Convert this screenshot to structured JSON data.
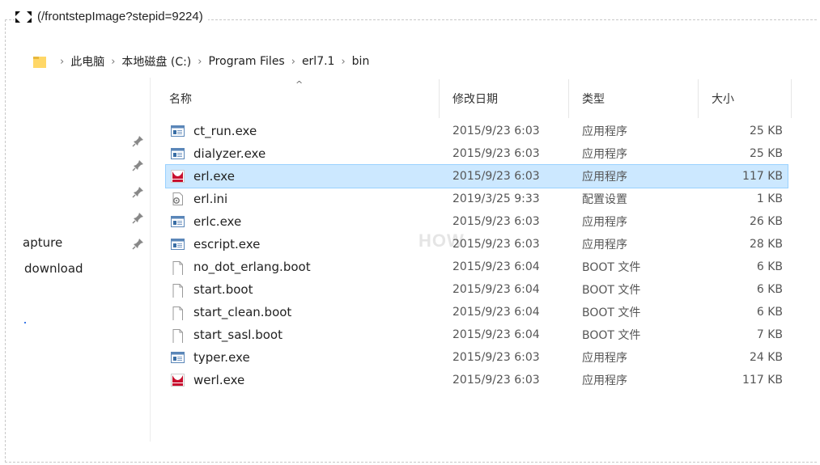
{
  "caption": "(/frontstepImage?stepid=9224)",
  "breadcrumb": [
    "此电脑",
    "本地磁盘 (C:)",
    "Program Files",
    "erl7.1",
    "bin"
  ],
  "columns": {
    "name": "名称",
    "date": "修改日期",
    "type": "类型",
    "size": "大小"
  },
  "sidebar": [
    {
      "label": "apture"
    },
    {
      "label": "download"
    }
  ],
  "watermark": "HOW",
  "files": [
    {
      "name": "ct_run.exe",
      "date": "2015/9/23 6:03",
      "type": "应用程序",
      "size": "25 KB",
      "icon": "exe-icon"
    },
    {
      "name": "dialyzer.exe",
      "date": "2015/9/23 6:03",
      "type": "应用程序",
      "size": "25 KB",
      "icon": "exe-icon"
    },
    {
      "name": "erl.exe",
      "date": "2015/9/23 6:03",
      "type": "应用程序",
      "size": "117 KB",
      "icon": "erlang-icon",
      "selected": true
    },
    {
      "name": "erl.ini",
      "date": "2019/3/25 9:33",
      "type": "配置设置",
      "size": "1 KB",
      "icon": "settings-file-icon"
    },
    {
      "name": "erlc.exe",
      "date": "2015/9/23 6:03",
      "type": "应用程序",
      "size": "26 KB",
      "icon": "exe-icon"
    },
    {
      "name": "escript.exe",
      "date": "2015/9/23 6:03",
      "type": "应用程序",
      "size": "28 KB",
      "icon": "exe-icon"
    },
    {
      "name": "no_dot_erlang.boot",
      "date": "2015/9/23 6:04",
      "type": "BOOT 文件",
      "size": "6 KB",
      "icon": "blank-file-icon"
    },
    {
      "name": "start.boot",
      "date": "2015/9/23 6:04",
      "type": "BOOT 文件",
      "size": "6 KB",
      "icon": "blank-file-icon"
    },
    {
      "name": "start_clean.boot",
      "date": "2015/9/23 6:04",
      "type": "BOOT 文件",
      "size": "6 KB",
      "icon": "blank-file-icon"
    },
    {
      "name": "start_sasl.boot",
      "date": "2015/9/23 6:04",
      "type": "BOOT 文件",
      "size": "7 KB",
      "icon": "blank-file-icon"
    },
    {
      "name": "typer.exe",
      "date": "2015/9/23 6:03",
      "type": "应用程序",
      "size": "24 KB",
      "icon": "exe-icon"
    },
    {
      "name": "werl.exe",
      "date": "2015/9/23 6:03",
      "type": "应用程序",
      "size": "117 KB",
      "icon": "erlang-icon"
    }
  ],
  "colors": {
    "selection": "#cce8ff",
    "selection_border": "#99d1ff",
    "folder": "#ffd767"
  }
}
